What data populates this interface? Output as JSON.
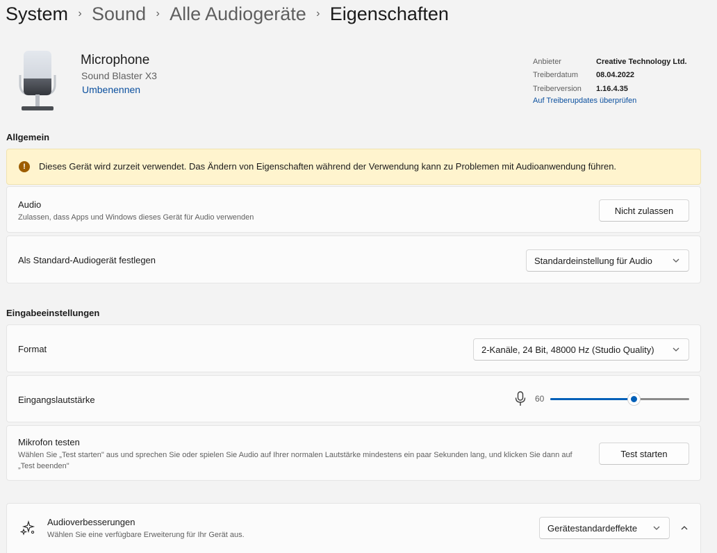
{
  "breadcrumb": {
    "items": [
      "System",
      "Sound",
      "Alle Audiogeräte",
      "Eigenschaften"
    ],
    "separator": "›"
  },
  "device": {
    "name": "Microphone",
    "model": "Sound Blaster X3",
    "rename_label": "Umbenennen",
    "icon": "microphone-device-icon"
  },
  "driver": {
    "vendor_label": "Anbieter",
    "vendor_value": "Creative Technology Ltd.",
    "date_label": "Treiberdatum",
    "date_value": "08.04.2022",
    "version_label": "Treiberversion",
    "version_value": "1.16.4.35",
    "update_link": "Auf Treiberupdates überprüfen"
  },
  "general": {
    "title": "Allgemein",
    "warning": "Dieses Gerät wird zurzeit verwendet. Das Ändern von Eigenschaften während der Verwendung kann zu Problemen mit Audioanwendung führen.",
    "audio_title": "Audio",
    "audio_subtitle": "Zulassen, dass Apps und Windows dieses Gerät für Audio verwenden",
    "audio_button": "Nicht zulassen",
    "default_title": "Als Standard-Audiogerät festlegen",
    "default_value": "Standardeinstellung für Audio"
  },
  "input": {
    "title": "Eingabeeinstellungen",
    "format_title": "Format",
    "format_value": "2-Kanäle, 24 Bit, 48000 Hz (Studio Quality)",
    "volume_title": "Eingangslautstärke",
    "volume_value": "60",
    "volume_level": 0.6,
    "test_title": "Mikrofon testen",
    "test_subtitle": "Wählen Sie „Test starten\" aus und sprechen Sie oder spielen Sie Audio auf Ihrer normalen Lautstärke mindestens ein paar Sekunden lang, und klicken Sie dann auf „Test beenden\"",
    "test_button": "Test starten"
  },
  "enhancements": {
    "title": "Audioverbesserungen",
    "subtitle": "Wählen Sie eine verfügbare Erweiterung für Ihr Gerät aus.",
    "value": "Gerätestandardeffekte"
  },
  "colors": {
    "accent": "#005fb8",
    "link": "#0a4f9e",
    "warning_bg": "#fff4ce",
    "warning_icon": "#9d5d00"
  }
}
